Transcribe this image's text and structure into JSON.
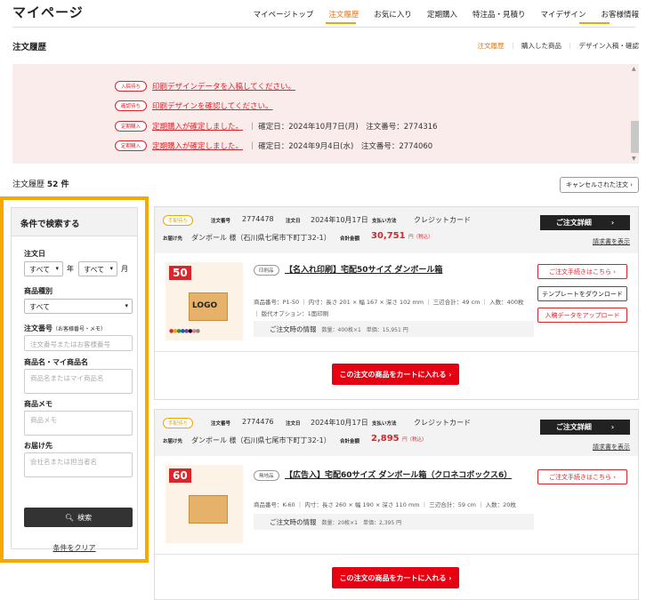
{
  "header": {
    "title": "マイページ",
    "nav": [
      "マイページトップ",
      "注文履歴",
      "お気に入り",
      "定期購入",
      "特注品・見積り",
      "マイデザイン",
      "お客様情報"
    ]
  },
  "page": {
    "title": "注文履歴",
    "subnav": [
      "注文履歴",
      "購入した商品",
      "デザイン入稿・確認"
    ]
  },
  "notices": [
    {
      "tag": "入稿待ち",
      "text": "印刷デザインデータを入稿してください。",
      "meta": ""
    },
    {
      "tag": "確認待ち",
      "text": "印刷デザインを確認してください。",
      "meta": ""
    },
    {
      "tag": "定期購入",
      "text": "定期購入が確定しました。",
      "meta": "｜ 確定日：2024年10月7日(月)　注文番号：2774316"
    },
    {
      "tag": "定期購入",
      "text": "定期購入が確定しました。",
      "meta": "｜ 確定日：2024年9月4日(水)　注文番号：2774060"
    }
  ],
  "history": {
    "label": "注文履歴",
    "count": "52 件",
    "cancel_button": "キャンセルされた注文 ›"
  },
  "search": {
    "title": "条件で検索する",
    "date_label": "注文日",
    "year_value": "すべて",
    "year_unit": "年",
    "month_value": "すべて",
    "month_unit": "月",
    "type_label": "商品種別",
    "type_value": "すべて",
    "order_no_label": "注文番号",
    "order_no_note": "（お客様番号・メモ）",
    "order_no_placeholder": "注文番号またはお客様番号",
    "product_label": "商品名・マイ商品名",
    "product_placeholder": "商品名またはマイ商品名",
    "memo_label": "商品メモ",
    "memo_placeholder": "商品メモ",
    "dest_label": "お届け先",
    "dest_placeholder": "会社名または担当者名",
    "search_button": "検索",
    "clear_link": "条件をクリア"
  },
  "orders": [
    {
      "badge": "手配待ち",
      "order_no_key": "注文番号",
      "order_no": "2774478",
      "date_key": "注文日",
      "date": "2024年10月17日",
      "pay_key": "支払い方法",
      "pay": "クレジットカード",
      "dest_key": "お届け先",
      "dest": "ダンボール 様（石川県七尾市下町丁32-1）",
      "total_key": "合計金額",
      "total": "30,751",
      "total_unit": "円（税込）",
      "detail_button": "ご注文詳細",
      "invoice_link": "請求書を表示",
      "item_type": "印刷品",
      "item_name": "【名入れ印刷】宅配50サイズ ダンボール箱",
      "thumb_number": "50",
      "thumb_logo": "LOGO",
      "spec": "商品番号：P1-50 ｜ 内寸：長さ 201 × 幅 167 × 深さ 102 mm ｜ 三辺合計：49 cm ｜ 入数：400枚",
      "option": "｜ 版代オプション：1面印刷",
      "info_label": "ご注文時の情報",
      "info_qty": "数量：400枚×1　単価：15,951 円",
      "buttons": [
        "ご注文手続きはこちら ›",
        "テンプレートをダウンロード",
        "入稿データをアップロード"
      ],
      "cart_button": "この注文の商品をカートに入れる ›"
    },
    {
      "badge": "手配待ち",
      "order_no_key": "注文番号",
      "order_no": "2774476",
      "date_key": "注文日",
      "date": "2024年10月17日",
      "pay_key": "支払い方法",
      "pay": "クレジットカード",
      "dest_key": "お届け先",
      "dest": "ダンボール 様（石川県七尾市下町丁32-1）",
      "total_key": "合計金額",
      "total": "2,895",
      "total_unit": "円（税込）",
      "detail_button": "ご注文詳細",
      "invoice_link": "請求書を表示",
      "item_type": "無地品",
      "item_name": "【広告入】宅配60サイズ ダンボール箱（クロネコボックス6）",
      "thumb_number": "60",
      "spec": "商品番号：K-60 ｜ 内寸：長さ 260 × 幅 190 × 深さ 110 mm ｜ 三辺合計：59 cm ｜ 入数：20枚",
      "info_label": "ご注文時の情報",
      "info_qty": "数量：20枚×1　単価：2,395 円",
      "buttons": [
        "ご注文手続きはこちら ›"
      ],
      "cart_button": "この注文の商品をカートに入れる ›"
    }
  ]
}
